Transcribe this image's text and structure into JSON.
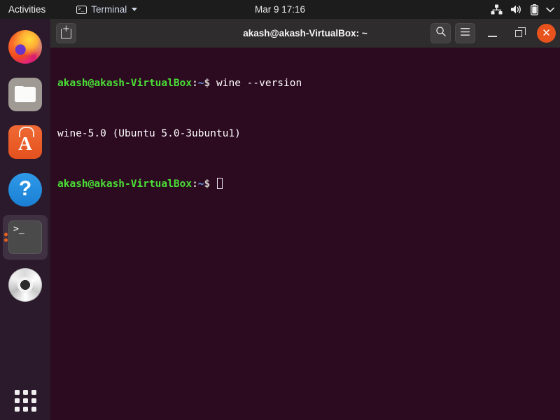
{
  "topbar": {
    "activities_label": "Activities",
    "app_menu_label": "Terminal",
    "app_menu_icon": "terminal-icon",
    "clock": "Mar 9  17:16",
    "tray": [
      {
        "name": "network-icon",
        "label": "network"
      },
      {
        "name": "volume-icon",
        "label": "volume"
      },
      {
        "name": "battery-icon",
        "label": "battery"
      },
      {
        "name": "chevron-down-icon",
        "label": "system-menu"
      }
    ]
  },
  "dock": {
    "items": [
      {
        "name": "dock-item-firefox",
        "label": "Firefox",
        "icon": "firefox-icon",
        "active": false,
        "running": false
      },
      {
        "name": "dock-item-files",
        "label": "Files",
        "icon": "files-icon",
        "active": false,
        "running": false
      },
      {
        "name": "dock-item-ubuntu-software",
        "label": "Ubuntu Software",
        "icon": "ubuntu-software-icon",
        "active": false,
        "running": false
      },
      {
        "name": "dock-item-help",
        "label": "Help",
        "icon": "help-icon",
        "active": false,
        "running": false
      },
      {
        "name": "dock-item-terminal",
        "label": "Terminal",
        "icon": "terminal-icon",
        "active": true,
        "running": true
      },
      {
        "name": "dock-item-disk",
        "label": "Disk Image",
        "icon": "optical-disc-icon",
        "active": false,
        "running": false
      }
    ],
    "show_applications_label": "Show Applications",
    "running_dot_color": "#e8601c"
  },
  "window": {
    "title": "akash@akash-VirtualBox: ~",
    "new_tab_label": "New Tab",
    "search_label": "Search",
    "menu_label": "Menu",
    "minimize_label": "Minimize",
    "maximize_label": "Maximize",
    "close_label": "Close",
    "close_color": "#e8521c"
  },
  "terminal": {
    "background": "#2c0a20",
    "prompt_user": "akash@akash-VirtualBox",
    "prompt_colon": ":",
    "prompt_path": "~",
    "prompt_dollar": "$ ",
    "lines": [
      {
        "type": "prompt",
        "command": "wine --version"
      },
      {
        "type": "output",
        "text": "wine-5.0 (Ubuntu 5.0-3ubuntu1)"
      },
      {
        "type": "prompt",
        "command": ""
      }
    ],
    "prompt_colors": {
      "user": "#4ade36",
      "path": "#6d9ff0",
      "text": "#ffffff"
    }
  }
}
